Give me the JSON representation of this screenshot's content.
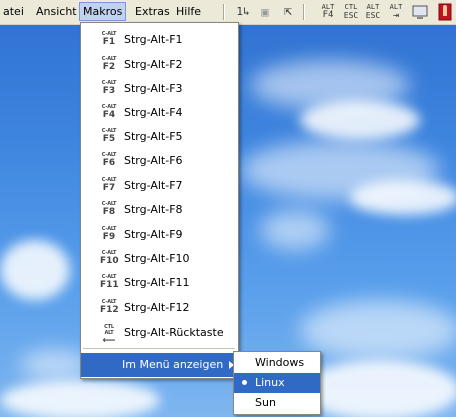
{
  "menubar": {
    "items": [
      {
        "label": "atei"
      },
      {
        "label": "Ansicht"
      },
      {
        "label": "Makros"
      },
      {
        "label": "Extras"
      },
      {
        "label": "Hilfe"
      }
    ],
    "toolbar": [
      {
        "icon": "cursor-key-icon",
        "text": "1↳"
      },
      {
        "icon": "image-frame-icon",
        "text": "▣"
      },
      {
        "icon": "select-cursor-icon",
        "text": "⇱"
      },
      {
        "icon": "alt-f4-icon",
        "top": "ALT",
        "bot": "F4"
      },
      {
        "icon": "ctl-esc-icon",
        "top": "CTL",
        "bot": "ESC"
      },
      {
        "icon": "alt-esc-icon",
        "top": "ALT",
        "bot": "ESC"
      },
      {
        "icon": "alt-tab-icon",
        "top": "ALT",
        "bot": "⇥"
      },
      {
        "icon": "monitor-icon",
        "text": "🖵"
      },
      {
        "icon": "exit-icon",
        "text": "🚪"
      }
    ]
  },
  "macros_menu": {
    "items": [
      {
        "key_top": "C-ALT",
        "key": "F1",
        "label": "Strg-Alt-F1"
      },
      {
        "key_top": "C-ALT",
        "key": "F2",
        "label": "Strg-Alt-F2"
      },
      {
        "key_top": "C-ALT",
        "key": "F3",
        "label": "Strg-Alt-F3"
      },
      {
        "key_top": "C-ALT",
        "key": "F4",
        "label": "Strg-Alt-F4"
      },
      {
        "key_top": "C-ALT",
        "key": "F5",
        "label": "Strg-Alt-F5"
      },
      {
        "key_top": "C-ALT",
        "key": "F6",
        "label": "Strg-Alt-F6"
      },
      {
        "key_top": "C-ALT",
        "key": "F7",
        "label": "Strg-Alt-F7"
      },
      {
        "key_top": "C-ALT",
        "key": "F8",
        "label": "Strg-Alt-F8"
      },
      {
        "key_top": "C-ALT",
        "key": "F9",
        "label": "Strg-Alt-F9"
      },
      {
        "key_top": "C-ALT",
        "key": "F10",
        "label": "Strg-Alt-F10"
      },
      {
        "key_top": "C-ALT",
        "key": "F11",
        "label": "Strg-Alt-F11"
      },
      {
        "key_top": "C-ALT",
        "key": "F12",
        "label": "Strg-Alt-F12"
      },
      {
        "key_top": "CTL ALT",
        "key": "⟵",
        "label": "Strg-Alt-Rücktaste"
      }
    ],
    "show_in_menu": {
      "label": "Im Menü anzeigen"
    }
  },
  "submenu": {
    "items": [
      {
        "label": "Windows",
        "selected": false
      },
      {
        "label": "Linux",
        "selected": true
      },
      {
        "label": "Sun",
        "selected": false
      }
    ]
  }
}
